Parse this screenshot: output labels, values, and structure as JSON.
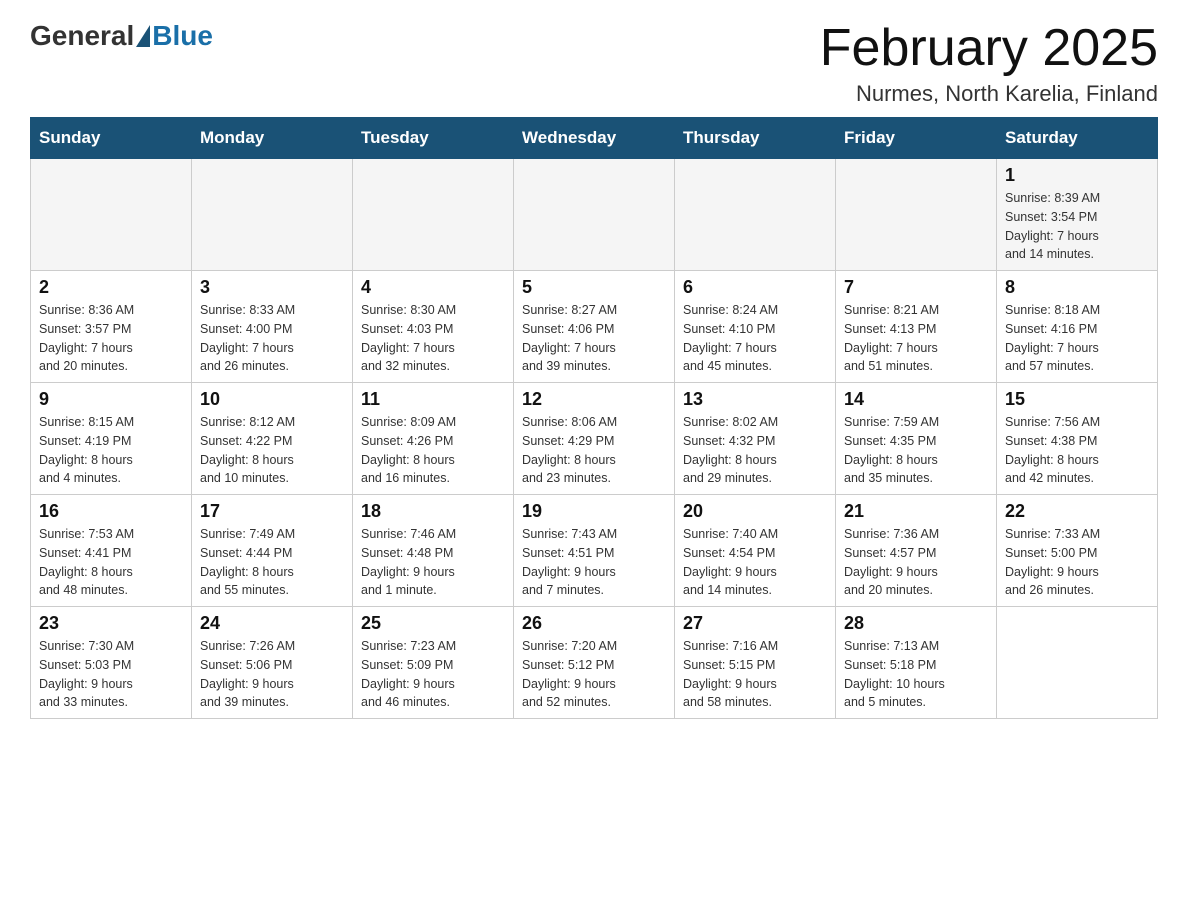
{
  "header": {
    "logo_general": "General",
    "logo_blue": "Blue",
    "title": "February 2025",
    "subtitle": "Nurmes, North Karelia, Finland"
  },
  "days_of_week": [
    "Sunday",
    "Monday",
    "Tuesday",
    "Wednesday",
    "Thursday",
    "Friday",
    "Saturday"
  ],
  "weeks": [
    {
      "days": [
        {
          "number": "",
          "info": ""
        },
        {
          "number": "",
          "info": ""
        },
        {
          "number": "",
          "info": ""
        },
        {
          "number": "",
          "info": ""
        },
        {
          "number": "",
          "info": ""
        },
        {
          "number": "",
          "info": ""
        },
        {
          "number": "1",
          "info": "Sunrise: 8:39 AM\nSunset: 3:54 PM\nDaylight: 7 hours\nand 14 minutes."
        }
      ]
    },
    {
      "days": [
        {
          "number": "2",
          "info": "Sunrise: 8:36 AM\nSunset: 3:57 PM\nDaylight: 7 hours\nand 20 minutes."
        },
        {
          "number": "3",
          "info": "Sunrise: 8:33 AM\nSunset: 4:00 PM\nDaylight: 7 hours\nand 26 minutes."
        },
        {
          "number": "4",
          "info": "Sunrise: 8:30 AM\nSunset: 4:03 PM\nDaylight: 7 hours\nand 32 minutes."
        },
        {
          "number": "5",
          "info": "Sunrise: 8:27 AM\nSunset: 4:06 PM\nDaylight: 7 hours\nand 39 minutes."
        },
        {
          "number": "6",
          "info": "Sunrise: 8:24 AM\nSunset: 4:10 PM\nDaylight: 7 hours\nand 45 minutes."
        },
        {
          "number": "7",
          "info": "Sunrise: 8:21 AM\nSunset: 4:13 PM\nDaylight: 7 hours\nand 51 minutes."
        },
        {
          "number": "8",
          "info": "Sunrise: 8:18 AM\nSunset: 4:16 PM\nDaylight: 7 hours\nand 57 minutes."
        }
      ]
    },
    {
      "days": [
        {
          "number": "9",
          "info": "Sunrise: 8:15 AM\nSunset: 4:19 PM\nDaylight: 8 hours\nand 4 minutes."
        },
        {
          "number": "10",
          "info": "Sunrise: 8:12 AM\nSunset: 4:22 PM\nDaylight: 8 hours\nand 10 minutes."
        },
        {
          "number": "11",
          "info": "Sunrise: 8:09 AM\nSunset: 4:26 PM\nDaylight: 8 hours\nand 16 minutes."
        },
        {
          "number": "12",
          "info": "Sunrise: 8:06 AM\nSunset: 4:29 PM\nDaylight: 8 hours\nand 23 minutes."
        },
        {
          "number": "13",
          "info": "Sunrise: 8:02 AM\nSunset: 4:32 PM\nDaylight: 8 hours\nand 29 minutes."
        },
        {
          "number": "14",
          "info": "Sunrise: 7:59 AM\nSunset: 4:35 PM\nDaylight: 8 hours\nand 35 minutes."
        },
        {
          "number": "15",
          "info": "Sunrise: 7:56 AM\nSunset: 4:38 PM\nDaylight: 8 hours\nand 42 minutes."
        }
      ]
    },
    {
      "days": [
        {
          "number": "16",
          "info": "Sunrise: 7:53 AM\nSunset: 4:41 PM\nDaylight: 8 hours\nand 48 minutes."
        },
        {
          "number": "17",
          "info": "Sunrise: 7:49 AM\nSunset: 4:44 PM\nDaylight: 8 hours\nand 55 minutes."
        },
        {
          "number": "18",
          "info": "Sunrise: 7:46 AM\nSunset: 4:48 PM\nDaylight: 9 hours\nand 1 minute."
        },
        {
          "number": "19",
          "info": "Sunrise: 7:43 AM\nSunset: 4:51 PM\nDaylight: 9 hours\nand 7 minutes."
        },
        {
          "number": "20",
          "info": "Sunrise: 7:40 AM\nSunset: 4:54 PM\nDaylight: 9 hours\nand 14 minutes."
        },
        {
          "number": "21",
          "info": "Sunrise: 7:36 AM\nSunset: 4:57 PM\nDaylight: 9 hours\nand 20 minutes."
        },
        {
          "number": "22",
          "info": "Sunrise: 7:33 AM\nSunset: 5:00 PM\nDaylight: 9 hours\nand 26 minutes."
        }
      ]
    },
    {
      "days": [
        {
          "number": "23",
          "info": "Sunrise: 7:30 AM\nSunset: 5:03 PM\nDaylight: 9 hours\nand 33 minutes."
        },
        {
          "number": "24",
          "info": "Sunrise: 7:26 AM\nSunset: 5:06 PM\nDaylight: 9 hours\nand 39 minutes."
        },
        {
          "number": "25",
          "info": "Sunrise: 7:23 AM\nSunset: 5:09 PM\nDaylight: 9 hours\nand 46 minutes."
        },
        {
          "number": "26",
          "info": "Sunrise: 7:20 AM\nSunset: 5:12 PM\nDaylight: 9 hours\nand 52 minutes."
        },
        {
          "number": "27",
          "info": "Sunrise: 7:16 AM\nSunset: 5:15 PM\nDaylight: 9 hours\nand 58 minutes."
        },
        {
          "number": "28",
          "info": "Sunrise: 7:13 AM\nSunset: 5:18 PM\nDaylight: 10 hours\nand 5 minutes."
        },
        {
          "number": "",
          "info": ""
        }
      ]
    }
  ]
}
